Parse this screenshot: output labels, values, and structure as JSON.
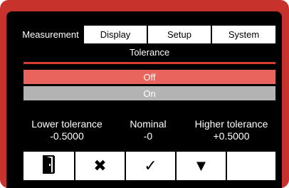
{
  "tabs": [
    {
      "label": "Measurement",
      "active": true
    },
    {
      "label": "Display",
      "active": false
    },
    {
      "label": "Setup",
      "active": false
    },
    {
      "label": "System",
      "active": false
    }
  ],
  "section": {
    "title": "Tolerance"
  },
  "options": [
    {
      "label": "Off",
      "selected": true
    },
    {
      "label": "On",
      "selected": false
    }
  ],
  "values": {
    "lower": {
      "label": "Lower tolerance",
      "value": "-0.5000"
    },
    "nominal": {
      "label": "Nominal",
      "value": "-0"
    },
    "higher": {
      "label": "Higher tolerance",
      "value": "+0.5000"
    }
  },
  "buttons": [
    {
      "icon": "exit-door-icon"
    },
    {
      "icon": "cancel-x-icon",
      "glyph": "✖"
    },
    {
      "icon": "confirm-check-icon",
      "glyph": "✓"
    },
    {
      "icon": "down-triangle-icon",
      "glyph": "▼"
    },
    {
      "icon": ""
    }
  ],
  "colors": {
    "frame": "#c8322c",
    "accent_rule": "#d93b33",
    "selected_option": "#e8645c",
    "unselected_option": "#b3b3b3"
  }
}
